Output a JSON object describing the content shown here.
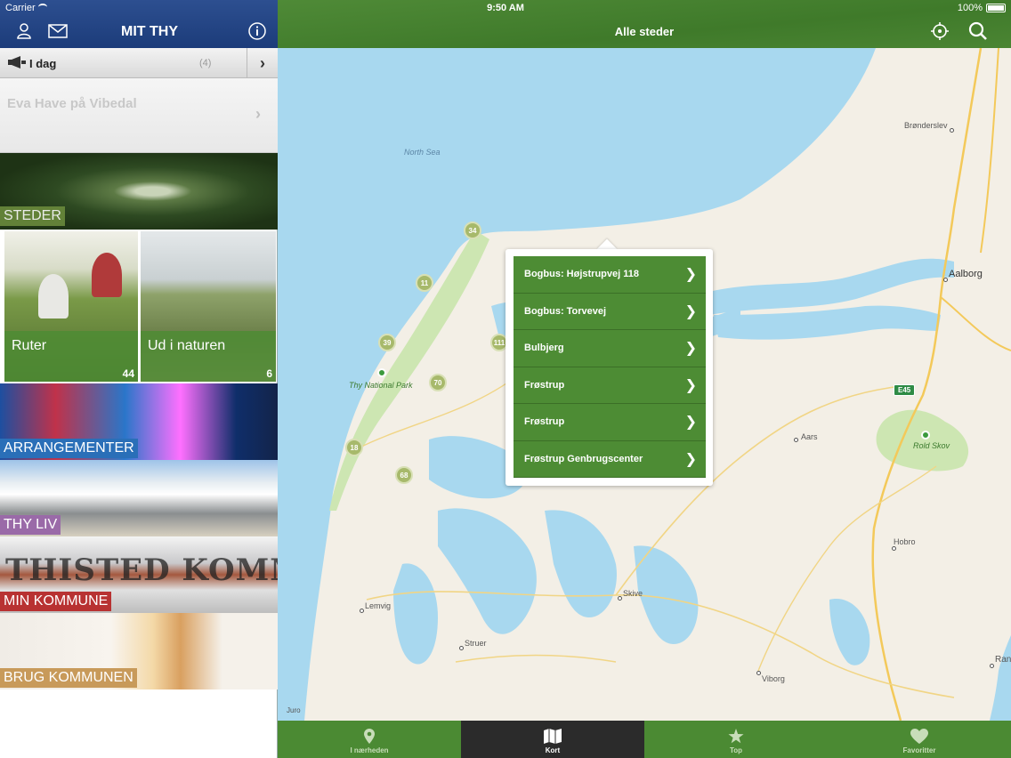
{
  "status_bar": {
    "carrier": "Carrier",
    "time": "9:50 AM",
    "battery": "100%"
  },
  "sidebar": {
    "title": "MIT THY",
    "today": {
      "label": "I dag",
      "count": "(4)"
    },
    "event": {
      "date": "",
      "title": "Eva Have på Vibedal"
    },
    "tiles": [
      {
        "label": "STEDER",
        "color": "#6a8a3c"
      },
      {
        "label": "Ruter",
        "count": "44",
        "color": "#4d8c34"
      },
      {
        "label": "Ud i naturen",
        "count": "6",
        "color": "#4d8c34"
      },
      {
        "label": "ARRANGEMENTER",
        "color": "#2a6fb8"
      },
      {
        "label": "THY LIV",
        "color": "#9a6aa8"
      },
      {
        "label": "MIN KOMMUNE",
        "color": "#b83232"
      },
      {
        "label": "BRUG KOMMUNEN",
        "color": "#c89a5a"
      }
    ]
  },
  "main": {
    "title": "Alle steder",
    "map": {
      "sea_label": "North Sea",
      "park_labels": [
        "Thy National Park",
        "Rold Skov"
      ],
      "cities": [
        "Brønderslev",
        "Aalborg",
        "Aars",
        "Hobro",
        "Skive",
        "Lemvig",
        "Struer",
        "Viborg",
        "Ran"
      ],
      "road": "E45",
      "clusters": [
        "34",
        "11",
        "39",
        "111",
        "70",
        "18",
        "68"
      ],
      "attribution": "Juro"
    },
    "popup_items": [
      "Bogbus: Højstrupvej 118",
      "Bogbus: Torvevej",
      "Bulbjerg",
      "Frøstrup",
      "Frøstrup",
      "Frøstrup Genbrugscenter"
    ]
  },
  "tab_bar": {
    "tabs": [
      {
        "label": "I nærheden",
        "icon": "pin-icon"
      },
      {
        "label": "Kort",
        "icon": "map-icon",
        "active": true
      },
      {
        "label": "Top",
        "icon": "star-icon"
      },
      {
        "label": "Favoritter",
        "icon": "heart-icon"
      }
    ]
  },
  "colors": {
    "accent_green": "#4d8c34",
    "header_blue": "#2d4f90",
    "water": "#a8d8ef"
  }
}
